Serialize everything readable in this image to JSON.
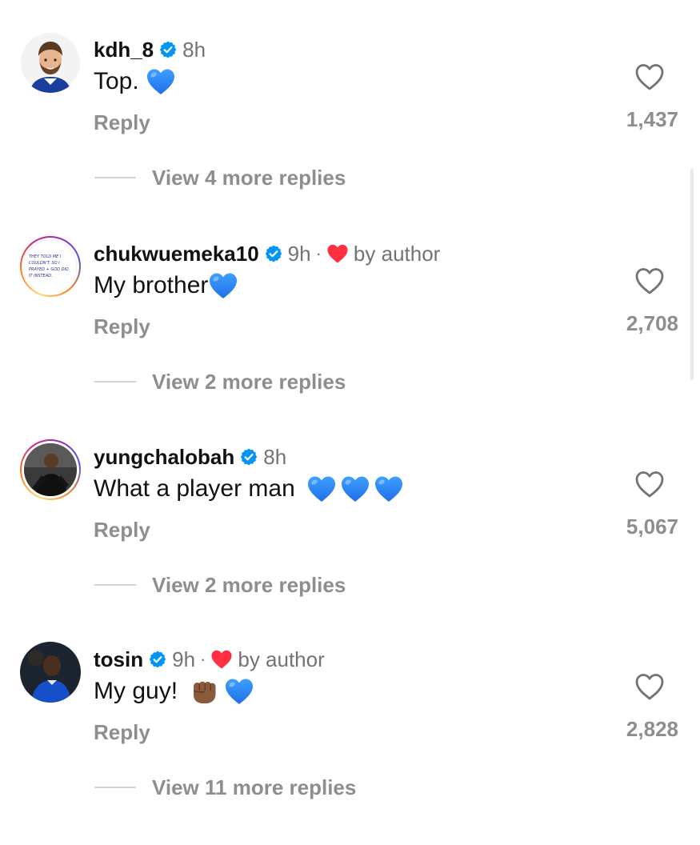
{
  "comments": [
    {
      "username": "kdh_8",
      "verified": true,
      "time": "8h",
      "liked_by_author": false,
      "text": "Top.",
      "emojis": [
        "blue-heart"
      ],
      "reply_label": "Reply",
      "likes": "1,437",
      "view_replies": "View 4 more replies"
    },
    {
      "username": "chukwuemeka10",
      "verified": true,
      "time": "9h",
      "liked_by_author": true,
      "separator": "·",
      "by_author_label": "by author",
      "text": "My brother",
      "emojis": [
        "blue-heart"
      ],
      "reply_label": "Reply",
      "likes": "2,708",
      "view_replies": "View 2 more replies",
      "avatar_text": [
        "THEY TOLD ME I",
        "COULDN'T. SO I",
        "PRAYED + GOD DID",
        "IT INSTEAD."
      ]
    },
    {
      "username": "yungchalobah",
      "verified": true,
      "time": "8h",
      "liked_by_author": false,
      "text": "What a player man",
      "emojis": [
        "blue-heart",
        "blue-heart",
        "blue-heart"
      ],
      "reply_label": "Reply",
      "likes": "5,067",
      "view_replies": "View 2 more replies"
    },
    {
      "username": "tosin",
      "verified": true,
      "time": "9h",
      "liked_by_author": true,
      "separator": "·",
      "by_author_label": "by author",
      "text": "My guy!",
      "emojis": [
        "fist-bump",
        "blue-heart"
      ],
      "reply_label": "Reply",
      "likes": "2,828",
      "view_replies": "View 11 more replies"
    }
  ],
  "colors": {
    "verified_blue": "#0095f6",
    "blue_heart": "#1f8bff",
    "red_heart": "#ff3040",
    "secondary_text": "#8e8e8e"
  }
}
